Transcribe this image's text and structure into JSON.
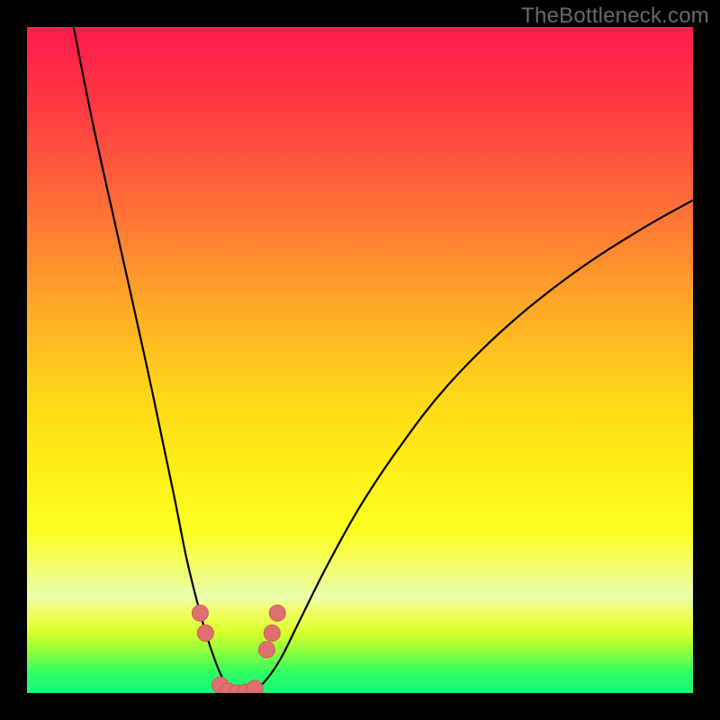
{
  "watermark": "TheBottleneck.com",
  "chart_data": {
    "type": "line",
    "title": "",
    "xlabel": "",
    "ylabel": "",
    "xlim": [
      0,
      100
    ],
    "ylim": [
      0,
      100
    ],
    "grid": false,
    "legend": false,
    "gradient_stops": [
      {
        "pos": 0,
        "color": "#ff1a4d"
      },
      {
        "pos": 12,
        "color": "#ff3a42"
      },
      {
        "pos": 26,
        "color": "#ff6a38"
      },
      {
        "pos": 40,
        "color": "#ffa22a"
      },
      {
        "pos": 54,
        "color": "#ffd41a"
      },
      {
        "pos": 66,
        "color": "#ffee15"
      },
      {
        "pos": 76,
        "color": "#fcff23"
      },
      {
        "pos": 82,
        "color": "#f1ff7a"
      },
      {
        "pos": 85.5,
        "color": "#e9ffb0"
      },
      {
        "pos": 88,
        "color": "#f2ff60"
      },
      {
        "pos": 91,
        "color": "#d6ff2a"
      },
      {
        "pos": 94,
        "color": "#88ff3e"
      },
      {
        "pos": 97,
        "color": "#2fff62"
      },
      {
        "pos": 100,
        "color": "#17f87c"
      }
    ],
    "series": [
      {
        "name": "bottleneck-curve",
        "color": "#000000",
        "x": [
          7,
          10,
          14,
          18,
          22,
          24,
          26,
          27.5,
          29,
          30.5,
          32,
          33.5,
          35.5,
          38,
          41,
          45,
          50,
          56,
          63,
          72,
          82,
          92,
          100
        ],
        "y": [
          100,
          85,
          67,
          49,
          30,
          20,
          12,
          7,
          3,
          0.5,
          0,
          0.2,
          1.5,
          5,
          11,
          19,
          28,
          37,
          46,
          55,
          63,
          69.5,
          74
        ]
      }
    ],
    "markers": {
      "name": "valley-markers",
      "color": "#e07070",
      "points": [
        {
          "x": 26.0,
          "y": 12.0
        },
        {
          "x": 26.8,
          "y": 9.0
        },
        {
          "x": 29.0,
          "y": 1.2
        },
        {
          "x": 30.2,
          "y": 0.3
        },
        {
          "x": 31.5,
          "y": 0.0
        },
        {
          "x": 32.8,
          "y": 0.1
        },
        {
          "x": 34.2,
          "y": 0.7
        },
        {
          "x": 36.0,
          "y": 6.5
        },
        {
          "x": 36.8,
          "y": 9.0
        },
        {
          "x": 37.6,
          "y": 12.0
        }
      ]
    }
  }
}
